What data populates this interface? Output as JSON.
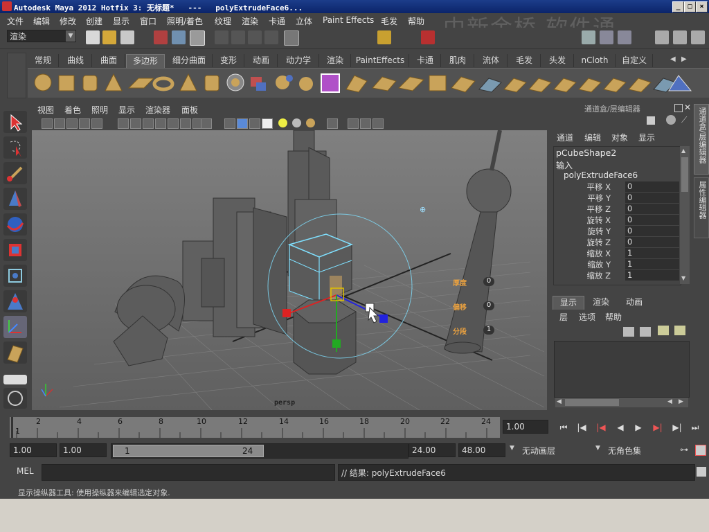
{
  "window": {
    "title": "Autodesk Maya 2012 Hotfix 3: 无标题*   ---   polyExtrudeFace6..."
  },
  "menubar": {
    "items": [
      "文件",
      "编辑",
      "修改",
      "创建",
      "显示",
      "窗口",
      "照明/着色",
      "纹理",
      "渲染",
      "卡通",
      "立体",
      "Paint Effects",
      "毛发",
      "帮助"
    ],
    "watermark": "中新金桥 软件通"
  },
  "statusline": {
    "menuset": "渲染"
  },
  "shelf": {
    "tabs": [
      "常规",
      "曲线",
      "曲面",
      "多边形",
      "细分曲面",
      "变形",
      "动画",
      "动力学",
      "渲染",
      "PaintEffects",
      "卡通",
      "肌肉",
      "流体",
      "毛发",
      "头发",
      "nCloth",
      "自定义"
    ],
    "active": "多边形"
  },
  "panel": {
    "menu": [
      "视图",
      "着色",
      "照明",
      "显示",
      "渲染器",
      "面板"
    ],
    "camera_label": "persp"
  },
  "manipulator_hud": {
    "fields": [
      {
        "label": "厚度",
        "value": "0"
      },
      {
        "label": "偏移",
        "value": "0"
      },
      {
        "label": "分段",
        "value": "1"
      }
    ]
  },
  "channelbox": {
    "header": "通道盒/层编辑器",
    "menu": [
      "通道",
      "编辑",
      "对象",
      "显示"
    ],
    "object_name": "pCubeShape2",
    "inputs_label": "输入",
    "node_name": "polyExtrudeFace6",
    "channels": [
      {
        "label": "平移 X",
        "value": "0"
      },
      {
        "label": "平移 Y",
        "value": "0"
      },
      {
        "label": "平移 Z",
        "value": "0"
      },
      {
        "label": "旋转 X",
        "value": "0"
      },
      {
        "label": "旋转 Y",
        "value": "0"
      },
      {
        "label": "旋转 Z",
        "value": "0"
      },
      {
        "label": "缩放 X",
        "value": "1"
      },
      {
        "label": "缩放 Y",
        "value": "1"
      },
      {
        "label": "缩放 Z",
        "value": "1"
      }
    ],
    "side_tabs": [
      "通道盒/层编辑器",
      "属性编辑器"
    ]
  },
  "layer_editor": {
    "tabs": [
      "显示",
      "渲染",
      "动画"
    ],
    "active_tab": "显示",
    "menu": [
      "层",
      "选项",
      "帮助"
    ]
  },
  "timeslider": {
    "ticks": [
      "2",
      "4",
      "6",
      "8",
      "10",
      "12",
      "14",
      "16",
      "18",
      "20",
      "22",
      "24"
    ],
    "current_frame_marker": "1",
    "current_time": "1.00"
  },
  "rangeslider": {
    "start_time": "1.00",
    "playback_start": "1.00",
    "range_start": "1",
    "range_end": "24",
    "playback_end": "24.00",
    "end_time": "48.00",
    "anim_layer": "无动画层",
    "character_set": "无角色集"
  },
  "commandline": {
    "lang": "MEL",
    "result": "// 结果: polyExtrudeFace6"
  },
  "helpline": {
    "text": "显示操纵器工具: 使用操纵器来编辑选定对象."
  },
  "colors": {
    "accent_cyan": "#7fe0ff",
    "hud_orange": "#e8a040",
    "selection_yellow": "#e0c000"
  }
}
